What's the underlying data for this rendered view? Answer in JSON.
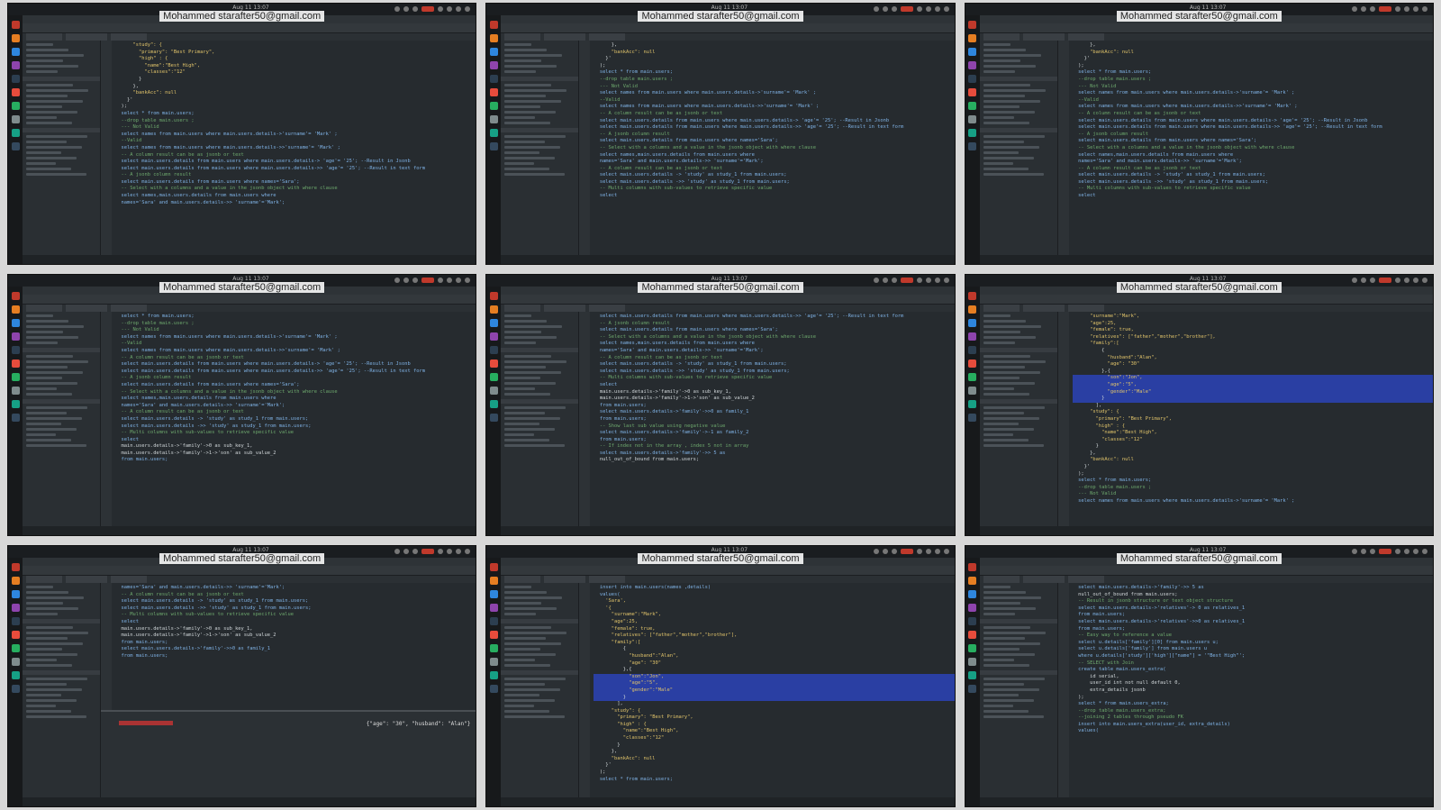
{
  "watermark": "Mohammed starafter50@gmail.com",
  "clock": "Aug 11 13:07",
  "panes": [
    {
      "lines": [
        "      \"study\": {",
        "        \"primary\": \"Best Primary\",",
        "        \"high\" : {",
        "          \"name\":\"Best High\",",
        "          \"classes\":\"12\"",
        "        }",
        "      },",
        "      \"bankAcc\": null",
        "    }'",
        "  );",
        "",
        "  select * from main.users;",
        "  --drop table main.users ;",
        "",
        "  --- Not Valid",
        "  select names from main.users where main.users.details->'surname'= 'Mark' ;",
        "  --Valid",
        "  select names from main.users where main.users.details->>'surname'= 'Mark' ;",
        "",
        "  -- A column result can be as jsonb or text",
        "  select main.users.details from main.users where main.users.details-> 'age'= '25'; --Result in Jsonb",
        "  select main.users.details from main.users where main.users.details->> 'age'= '25'; --Result in text form",
        "",
        "  -- A jsonb column result",
        "  select main.users.details from main.users where names='Sara';",
        "",
        "  -- Select with a columns and a value in the jsonb object with where clause",
        "  select names,main.users.details from main.users where",
        "  names='Sara' and main.users.details->> 'surname'='Mark';"
      ]
    },
    {
      "lines": [
        "      },",
        "      \"bankAcc\": null",
        "    }'",
        "  );",
        "",
        "  select * from main.users;",
        "  --drop table main.users ;",
        "",
        "  --- Not Valid",
        "  select names from main.users where main.users.details->'surname'= 'Mark' ;",
        "  --Valid",
        "  select names from main.users where main.users.details->>'surname'= 'Mark' ;",
        "",
        "  -- A column result can be as jsonb or text",
        "  select main.users.details from main.users where main.users.details-> 'age'= '25'; --Result in Jsonb",
        "  select main.users.details from main.users where main.users.details->> 'age'= '25'; --Result in text form",
        "",
        "  -- A jsonb column result",
        "  select main.users.details from main.users where names='Sara';",
        "",
        "  -- Select with a columns and a value in the jsonb object with where clause",
        "  select names,main.users.details from main.users where",
        "  names='Sara' and main.users.details->> 'surname'='Mark';",
        "",
        "  -- A column result can be as jsonb or text",
        "  select main.users.details -> 'study' as study_1 from main.users;",
        "  select main.users.details ->> 'study' as study_1 from main.users;",
        "",
        "  -- Multi columns with sub-values to retrieve specific value",
        "  select"
      ]
    },
    {
      "lines": [
        "      },",
        "      \"bankAcc\": null",
        "    }'",
        "  );",
        "",
        "  select * from main.users;",
        "  --drop table main.users ;",
        "",
        "  --- Not Valid",
        "  select names from main.users where main.users.details->'surname'= 'Mark' ;",
        "  --Valid",
        "  select names from main.users where main.users.details->>'surname'= 'Mark' ;",
        "",
        "  -- A column result can be as jsonb or text",
        "  select main.users.details from main.users where main.users.details-> 'age'= '25'; --Result in Jsonb",
        "  select main.users.details from main.users where main.users.details->> 'age'= '25'; --Result in text form",
        "",
        "  -- A jsonb column result",
        "  select main.users.details from main.users where names='Sara';",
        "",
        "  -- Select with a columns and a value in the jsonb object with where clause",
        "  select names,main.users.details from main.users where",
        "  names='Sara' and main.users.details->> 'surname'='Mark';",
        "",
        "  -- A column result can be as jsonb or text",
        "  select main.users.details -> 'study' as study_1 from main.users;",
        "  select main.users.details ->> 'study' as study_1 from main.users;",
        "",
        "  -- Multi columns with sub-values to retrieve specific value",
        "  select"
      ]
    },
    {
      "lines": [
        "  select * from main.users;",
        "  --drop table main.users ;",
        "",
        "  --- Not Valid",
        "  select names from main.users where main.users.details->'surname'= 'Mark' ;",
        "  --Valid",
        "  select names from main.users where main.users.details->>'surname'= 'Mark' ;",
        "",
        "  -- A column result can be as jsonb or text",
        "  select main.users.details from main.users where main.users.details-> 'age'= '25'; --Result in Jsonb",
        "  select main.users.details from main.users where main.users.details->> 'age'= '25'; --Result in text form",
        "",
        "  -- A jsonb column result",
        "  select main.users.details from main.users where names='Sara';",
        "",
        "  -- Select with a columns and a value in the jsonb object with where clause",
        "  select names,main.users.details from main.users where",
        "  names='Sara' and main.users.details->> 'surname'='Mark';",
        "",
        "  -- A column result can be as jsonb or text",
        "  select main.users.details -> 'study' as study_1 from main.users;",
        "  select main.users.details ->> 'study' as study_1 from main.users;",
        "",
        "  -- Multi columns with sub-values to retrieve specific value",
        "  select",
        "  main.users.details->'family'->0 as sub_key_1,",
        "  main.users.details->'family'->1->'son' as sub_value_2",
        "  from main.users;"
      ]
    },
    {
      "lines": [
        "  select main.users.details from main.users where main.users.details->> 'age'= '25'; --Result in text form",
        "",
        "  -- A jsonb column result",
        "  select main.users.details from main.users where names='Sara';",
        "",
        "  -- Select with a columns and a value in the jsonb object with where clause",
        "  select names,main.users.details from main.users where",
        "  names='Sara' and main.users.details->> 'surname'='Mark';",
        "",
        "  -- A column result can be as jsonb or text",
        "  select main.users.details -> 'study' as study_1 from main.users;",
        "  select main.users.details ->> 'study' as study_1 from main.users;",
        "",
        "  -- Multi columns with sub-values to retrieve specific value",
        "  select",
        "  main.users.details->'family'->0 as sub_key_1,",
        "  main.users.details->'family'->1->'son' as sub_value_2",
        "  from main.users;",
        "",
        "",
        "  select main.users.details->'family'->>0 as family_1",
        "  from main.users;",
        "",
        "  -- Show last sub value using negative value",
        "  select main.users.details->'family'->-1 as family_2",
        "  from main.users;",
        "",
        "  -- If index not in the array , index 5 not in array",
        "  select main.users.details->'family'->> 5 as",
        "  null_out_of_bound from main.users;"
      ]
    },
    {
      "lines": [
        "      \"surname\":\"Mark\",",
        "      \"age\":25,",
        "      \"female\": true,",
        "      \"relatives\": [\"father\",\"mother\",\"brother\"],",
        "      \"family\":[",
        "          {",
        "            \"husband\":\"Alan\",",
        "            \"age\": \"30\"",
        "          },{",
        "            \"son\":\"Jon\",",
        "            \"age\":\"5\",",
        "            \"gender\":\"Male\"",
        "          }",
        "        ],",
        "      \"study\": {",
        "        \"primary\": \"Best Primary\",",
        "        \"high\" : {",
        "          \"name\":\"Best High\",",
        "          \"classes\":\"12\"",
        "        }",
        "      },",
        "      \"bankAcc\": null",
        "    }'",
        "  );",
        "",
        "  select * from main.users;",
        "  --drop table main.users ;",
        "",
        "  --- Not Valid",
        "  select names from main.users where main.users.details->'surname'= 'Mark' ;"
      ]
    },
    {
      "lines": [
        "  names='Sara' and main.users.details->> 'surname'='Mark';",
        "",
        "  -- A column result can be as jsonb or text",
        "  select main.users.details -> 'study' as study_1 from main.users;",
        "  select main.users.details ->> 'study' as study_1 from main.users;",
        "",
        "  -- Multi columns with sub-values to retrieve specific value",
        "  select",
        "  main.users.details->'family'->0 as sub_key_1,",
        "  main.users.details->'family'->1->'son' as sub_value_2",
        "  from main.users;",
        "",
        "",
        "  select main.users.details->'family'->>0 as family_1",
        "  from main.users;"
      ]
    },
    {
      "lines": [
        "  insert into main.users(names ,details)",
        "  values(",
        "    'Sara',",
        "    '{",
        "      \"surname\":\"Mark\",",
        "      \"age\":25,",
        "      \"female\": true,",
        "      \"relatives\": [\"father\",\"mother\",\"brother\"],",
        "      \"family\":[",
        "          {",
        "            \"husband\":\"Alan\",",
        "            \"age\": \"30\"",
        "          },{",
        "            \"son\":\"Jon\",",
        "            \"age\":\"5\",",
        "            \"gender\":\"Male\"",
        "          }",
        "        ],",
        "      \"study\": {",
        "        \"primary\": \"Best Primary\",",
        "        \"high\" : {",
        "          \"name\":\"Best High\",",
        "          \"classes\":\"12\"",
        "        }",
        "      },",
        "      \"bankAcc\": null",
        "    }'",
        "  );",
        "",
        "  select * from main.users;"
      ]
    },
    {
      "lines": [
        "  select main.users.details->'family'->> 5 as",
        "  null_out_of_bound from main.users;",
        "",
        "  -- Result in jsonb structure or text object structure",
        "  select main.users.details->'relatives'-> 0 as relatives_1",
        "  from main.users;",
        "",
        "  select main.users.details->'relatives'->>0 as relatives_1",
        "  from main.users;",
        "",
        "  -- Easy way to reference a value",
        "  select u.details['family'][0] from main.users u;",
        "",
        "  select u.details['family'] from main.users u",
        "  where u.details['study']['high'][\"name\"] = '\"Best High\"';",
        "",
        "",
        "  -- SELECT with Join",
        "  create table main.users_extra(",
        "      id serial,",
        "      user_id int not null default 0,",
        "      extra_details jsonb",
        "  );",
        "",
        "  select * from main.users_extra;",
        "  --drop table main.users_extra;",
        "",
        "  --joining 2 tables through pseudo FK",
        "  insert into main.users_extra(user_id, extra_details)",
        "  values("
      ]
    }
  ],
  "results_preview": "{\"age\": \"30\", \"husband\": \"Alan\"}"
}
